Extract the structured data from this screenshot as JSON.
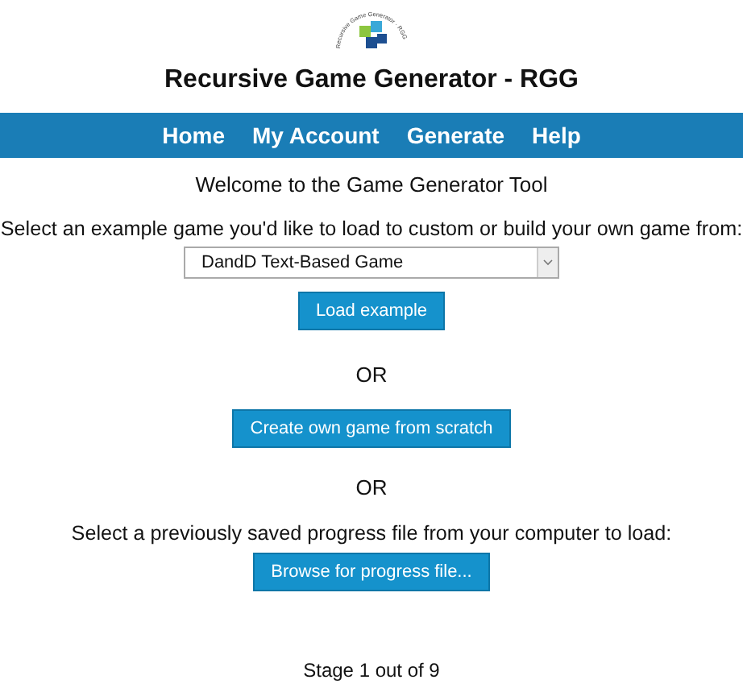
{
  "logo": {
    "text": "Recursive Game Generator · RGG"
  },
  "title": "Recursive Game Generator - RGG",
  "nav": [
    {
      "label": "Home"
    },
    {
      "label": "My Account"
    },
    {
      "label": "Generate"
    },
    {
      "label": "Help"
    }
  ],
  "welcome": "Welcome to the Game Generator Tool",
  "select_prompt": "Select an example game you'd like to load to custom or build your own game from:",
  "example_select": {
    "value": "DandD Text-Based Game"
  },
  "load_button": "Load example",
  "or_1": "OR",
  "create_button": "Create own game from scratch",
  "or_2": "OR",
  "file_prompt": "Select a previously saved progress file from your computer to load:",
  "browse_button": "Browse for progress file...",
  "stage": "Stage 1 out of 9"
}
